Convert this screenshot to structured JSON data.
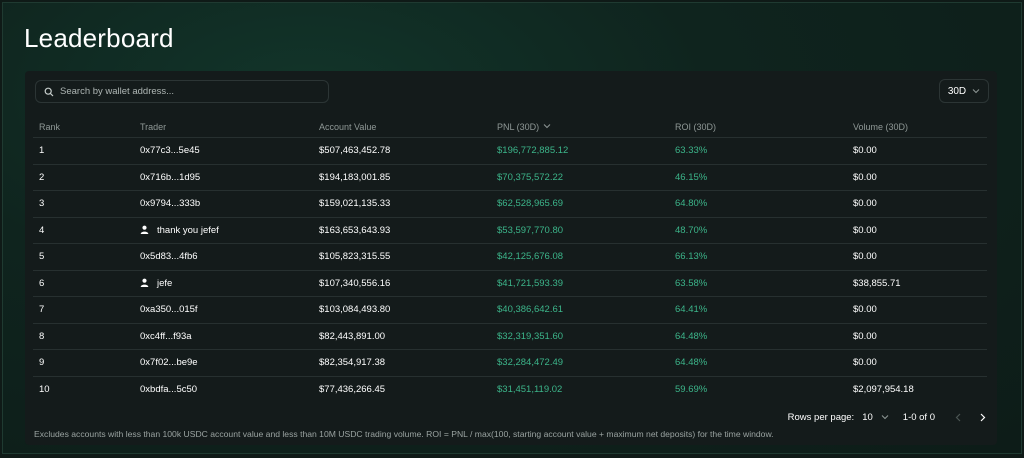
{
  "page": {
    "title": "Leaderboard"
  },
  "search": {
    "placeholder": "Search by wallet address..."
  },
  "period": {
    "value": "30D"
  },
  "columns": {
    "rank": "Rank",
    "trader": "Trader",
    "account_value": "Account Value",
    "pnl": "PNL (30D)",
    "roi": "ROI (30D)",
    "volume": "Volume (30D)"
  },
  "rows": [
    {
      "rank": "1",
      "trader": "0x77c3...5e45",
      "user_icon": false,
      "account_value": "$507,463,452.78",
      "pnl": "$196,772,885.12",
      "roi": "63.33%",
      "volume": "$0.00"
    },
    {
      "rank": "2",
      "trader": "0x716b...1d95",
      "user_icon": false,
      "account_value": "$194,183,001.85",
      "pnl": "$70,375,572.22",
      "roi": "46.15%",
      "volume": "$0.00"
    },
    {
      "rank": "3",
      "trader": "0x9794...333b",
      "user_icon": false,
      "account_value": "$159,021,135.33",
      "pnl": "$62,528,965.69",
      "roi": "64.80%",
      "volume": "$0.00"
    },
    {
      "rank": "4",
      "trader": "thank you jefef",
      "user_icon": true,
      "account_value": "$163,653,643.93",
      "pnl": "$53,597,770.80",
      "roi": "48.70%",
      "volume": "$0.00"
    },
    {
      "rank": "5",
      "trader": "0x5d83...4fb6",
      "user_icon": false,
      "account_value": "$105,823,315.55",
      "pnl": "$42,125,676.08",
      "roi": "66.13%",
      "volume": "$0.00"
    },
    {
      "rank": "6",
      "trader": "jefe",
      "user_icon": true,
      "account_value": "$107,340,556.16",
      "pnl": "$41,721,593.39",
      "roi": "63.58%",
      "volume": "$38,855.71"
    },
    {
      "rank": "7",
      "trader": "0xa350...015f",
      "user_icon": false,
      "account_value": "$103,084,493.80",
      "pnl": "$40,386,642.61",
      "roi": "64.41%",
      "volume": "$0.00"
    },
    {
      "rank": "8",
      "trader": "0xc4ff...f93a",
      "user_icon": false,
      "account_value": "$82,443,891.00",
      "pnl": "$32,319,351.60",
      "roi": "64.48%",
      "volume": "$0.00"
    },
    {
      "rank": "9",
      "trader": "0x7f02...be9e",
      "user_icon": false,
      "account_value": "$82,354,917.38",
      "pnl": "$32,284,472.49",
      "roi": "64.48%",
      "volume": "$0.00"
    },
    {
      "rank": "10",
      "trader": "0xbdfa...5c50",
      "user_icon": false,
      "account_value": "$77,436,266.45",
      "pnl": "$31,451,119.02",
      "roi": "59.69%",
      "volume": "$2,097,954.18"
    }
  ],
  "pagination": {
    "rows_per_page_label": "Rows per page:",
    "rows_per_page_value": "10",
    "range": "1-0 of 0"
  },
  "footnote": "Excludes accounts with less than 100k USDC account value and less than 10M USDC trading volume. ROI = PNL / max(100, starting account value + maximum net deposits) for the time window.",
  "colors": {
    "positive": "#3cb58a",
    "panel": "#141b1b",
    "background": "#0f241e"
  },
  "icons": {
    "search": "search-icon",
    "chevron": "chevron-down-icon",
    "user": "user-icon",
    "prev": "chevron-left-icon",
    "next": "chevron-right-icon"
  }
}
